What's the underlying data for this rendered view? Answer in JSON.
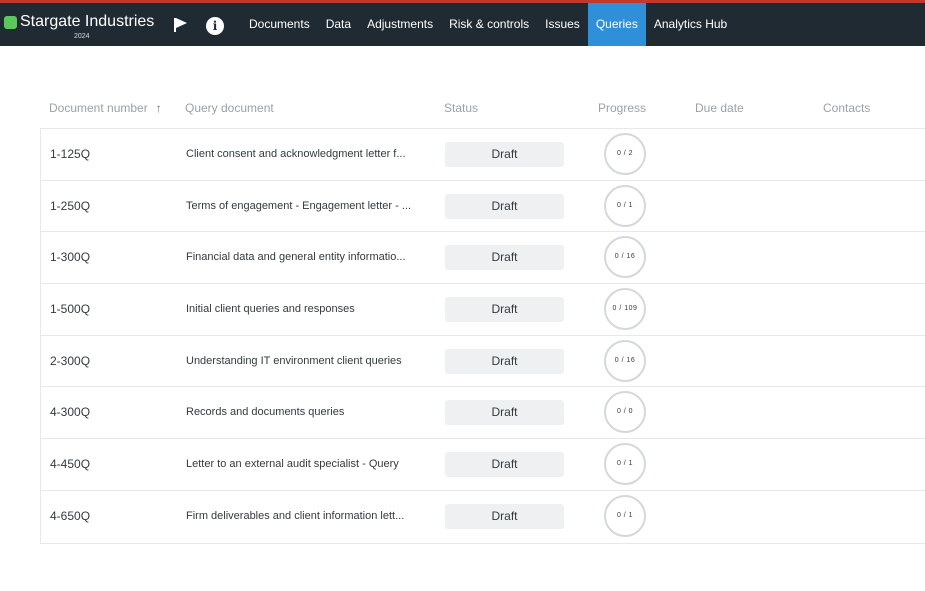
{
  "header": {
    "brand_name": "Stargate Industries",
    "brand_year": "2024",
    "flag_icon": "flag-icon",
    "info_icon": "info-icon",
    "info_glyph": "i",
    "nav": [
      {
        "label": "Documents",
        "active": false
      },
      {
        "label": "Data",
        "active": false
      },
      {
        "label": "Adjustments",
        "active": false
      },
      {
        "label": "Risk & controls",
        "active": false
      },
      {
        "label": "Issues",
        "active": false
      },
      {
        "label": "Queries",
        "active": true
      },
      {
        "label": "Analytics Hub",
        "active": false
      }
    ],
    "colors": {
      "bar": "#1f2a33",
      "active": "#2f8fd8",
      "brand_dot": "#5cc85c"
    }
  },
  "table": {
    "columns": {
      "document_number": "Document number",
      "query_document": "Query document",
      "status": "Status",
      "progress": "Progress",
      "due_date": "Due date",
      "contacts": "Contacts"
    },
    "sort_icon": "sort-arrow-up-icon",
    "sort_glyph": "↑",
    "rows": [
      {
        "number": "1-125Q",
        "document": "Client consent and acknowledgment letter f...",
        "status": "Draft",
        "progress": "0 / 2"
      },
      {
        "number": "1-250Q",
        "document": "Terms of engagement - Engagement letter - ...",
        "status": "Draft",
        "progress": "0 / 1"
      },
      {
        "number": "1-300Q",
        "document": "Financial data and general entity informatio...",
        "status": "Draft",
        "progress": "0 / 16"
      },
      {
        "number": "1-500Q",
        "document": "Initial client queries and responses",
        "status": "Draft",
        "progress": "0 / 109"
      },
      {
        "number": "2-300Q",
        "document": "Understanding IT environment client queries",
        "status": "Draft",
        "progress": "0 / 16"
      },
      {
        "number": "4-300Q",
        "document": "Records and documents queries",
        "status": "Draft",
        "progress": "0 / 0"
      },
      {
        "number": "4-450Q",
        "document": "Letter to an external audit specialist - Query",
        "status": "Draft",
        "progress": "0 / 1"
      },
      {
        "number": "4-650Q",
        "document": "Firm deliverables and client information lett...",
        "status": "Draft",
        "progress": "0 / 1"
      }
    ]
  }
}
